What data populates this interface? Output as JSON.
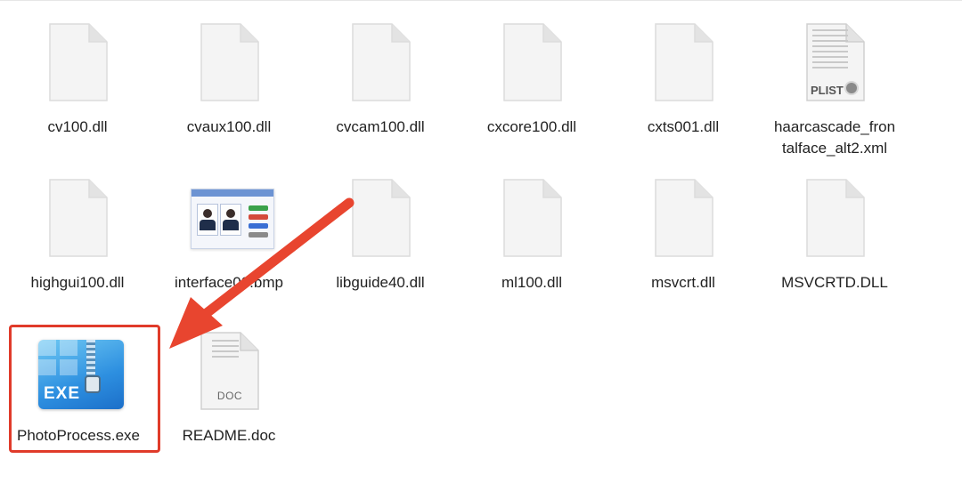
{
  "files": [
    {
      "name": "cv100.dll",
      "kind": "doc"
    },
    {
      "name": "cvaux100.dll",
      "kind": "doc"
    },
    {
      "name": "cvcam100.dll",
      "kind": "doc"
    },
    {
      "name": "cxcore100.dll",
      "kind": "doc"
    },
    {
      "name": "cxts001.dll",
      "kind": "doc"
    },
    {
      "name": "haarcascade_fron\ntalface_alt2.xml",
      "kind": "plist",
      "tag": "PLIST"
    },
    {
      "name": "highgui100.dll",
      "kind": "doc"
    },
    {
      "name": "interface0",
      "name_suffix": "bmp",
      "kind": "image"
    },
    {
      "name": "libguide40.dll",
      "kind": "doc"
    },
    {
      "name": "ml100.dll",
      "kind": "doc"
    },
    {
      "name": "msvcrt.dll",
      "kind": "doc"
    },
    {
      "name": "MSVCRTD.DLL",
      "kind": "doc"
    },
    {
      "name": "PhotoProcess.exe",
      "kind": "exe",
      "tag": "EXE"
    },
    {
      "name": "README.doc",
      "kind": "doc",
      "tag": "DOC"
    }
  ],
  "annotation": {
    "highlight_color": "#e03b2a",
    "arrow_color": "#e8452f",
    "target": "PhotoProcess.exe"
  }
}
